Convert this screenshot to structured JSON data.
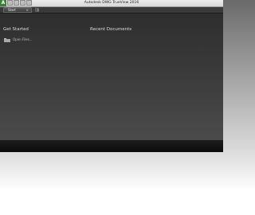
{
  "window": {
    "title": "Autodesk DWG TrueView 2016"
  },
  "quick_access": {
    "logo_label": "A",
    "buttons": [
      "open-file-icon",
      "save-icon",
      "print-icon",
      "undo-icon"
    ]
  },
  "tabs": {
    "items": [
      {
        "label": "Start",
        "close_glyph": "×"
      }
    ],
    "add_glyph": "+"
  },
  "start_page": {
    "get_started": {
      "title": "Get Started",
      "open_label": "Open Files..."
    },
    "recent_documents": {
      "title": "Recent Documents"
    }
  }
}
